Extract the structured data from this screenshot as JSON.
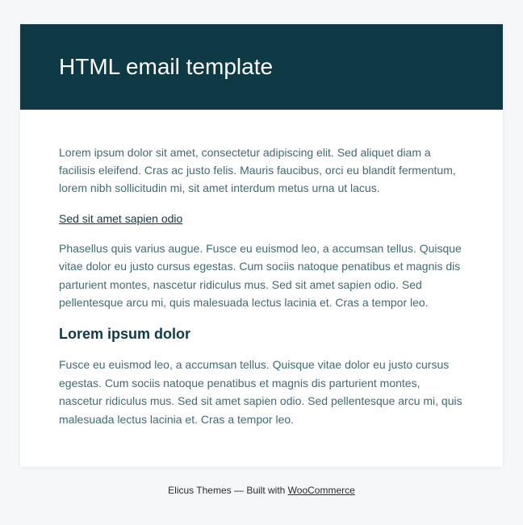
{
  "header": {
    "title": "HTML email template"
  },
  "body": {
    "paragraph1": "Lorem ipsum dolor sit amet, consectetur adipiscing elit. Sed aliquet diam a facilisis eleifend. Cras ac justo felis. Mauris faucibus, orci eu blandit fermentum, lorem nibh sollicitudin mi, sit amet interdum metus urna ut lacus.",
    "link1": "Sed sit amet sapien odio",
    "paragraph2": "Phasellus quis varius augue. Fusce eu euismod leo, a accumsan tellus. Quisque vitae dolor eu justo cursus egestas. Cum sociis natoque penatibus et magnis dis parturient montes, nascetur ridiculus mus. Sed sit amet sapien odio. Sed pellentesque arcu mi, quis malesuada lectus lacinia et. Cras a tempor leo.",
    "heading1": "Lorem ipsum dolor",
    "paragraph3": "Fusce eu euismod leo, a accumsan tellus. Quisque vitae dolor eu justo cursus egestas. Cum sociis natoque penatibus et magnis dis parturient montes, nascetur ridiculus mus. Sed sit amet sapien odio. Sed pellentesque arcu mi, quis malesuada lectus lacinia et. Cras a tempor leo."
  },
  "footer": {
    "prefix": "Elicus Themes — Built with ",
    "link": "WooCommerce"
  }
}
